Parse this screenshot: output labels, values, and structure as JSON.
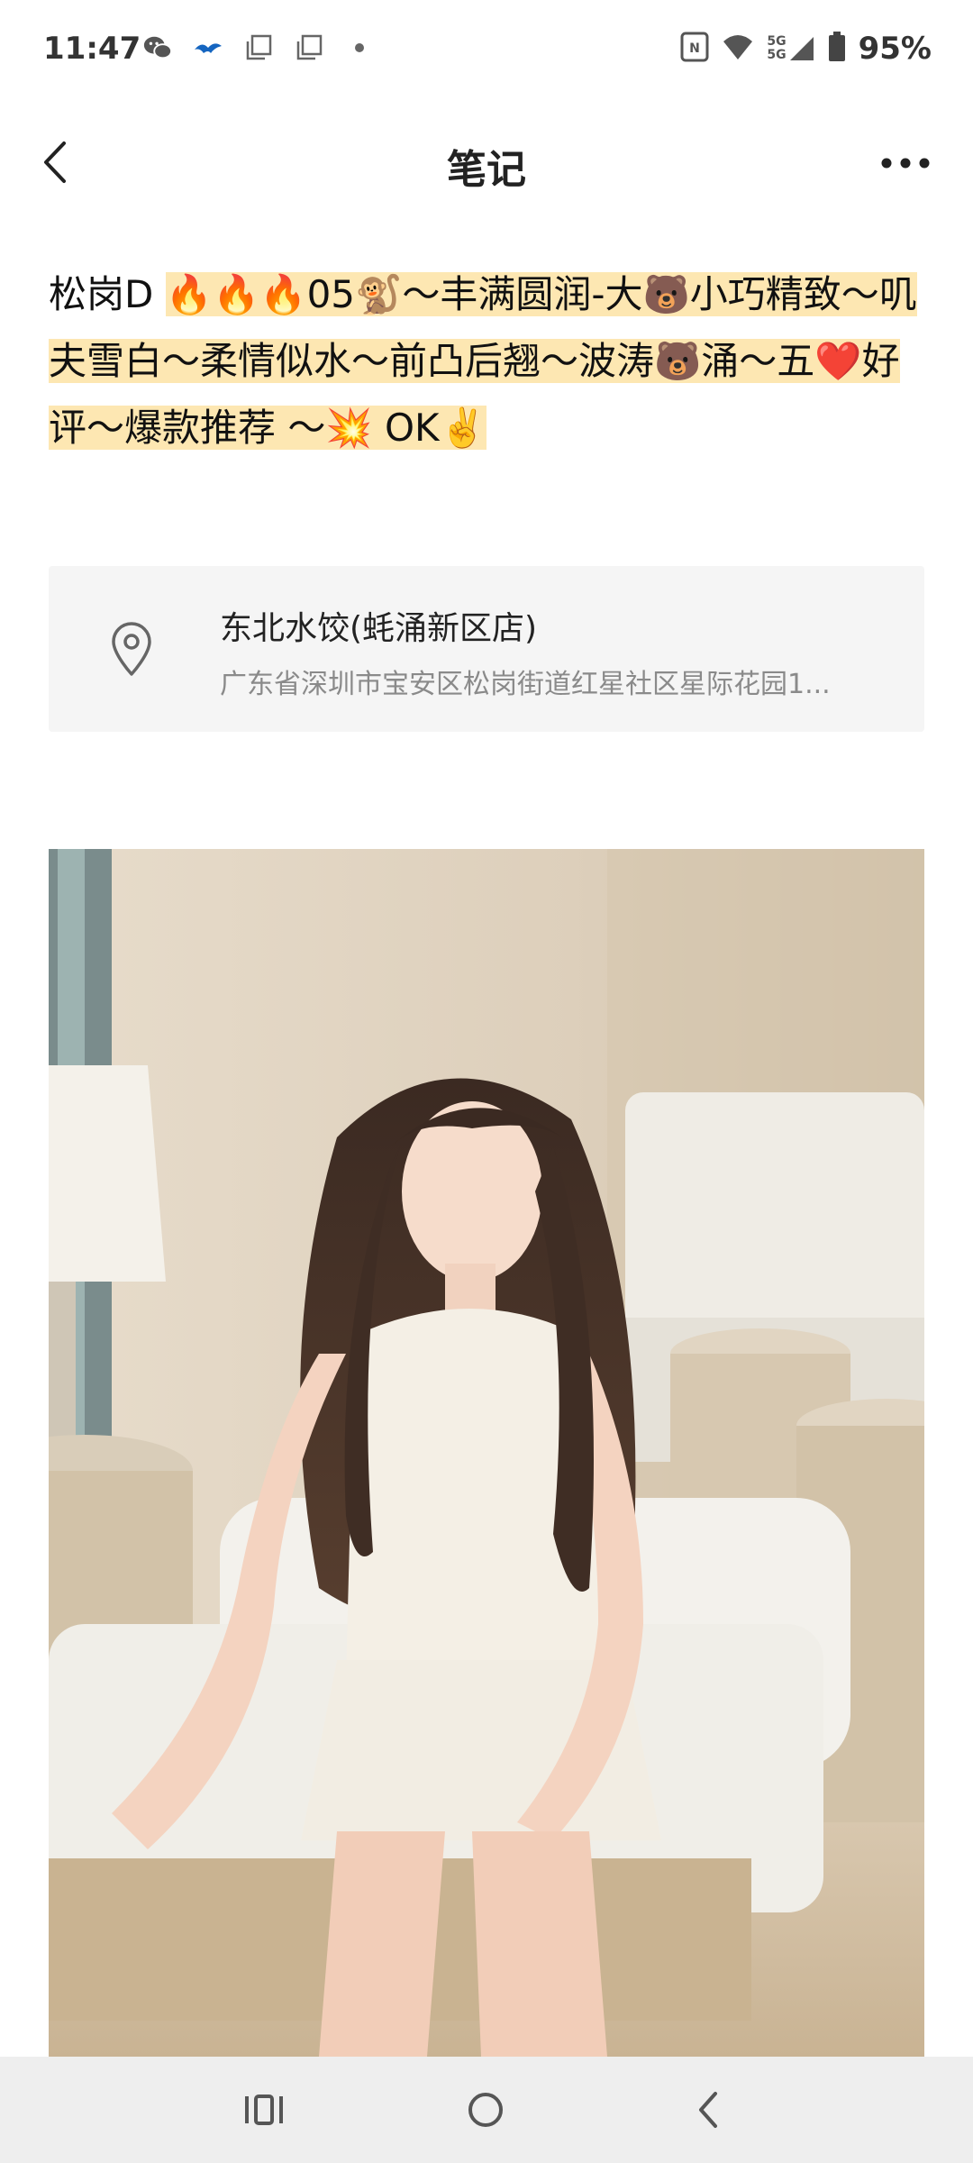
{
  "status_bar": {
    "time": "11:47",
    "battery": "95%",
    "icons": [
      "wechat-icon",
      "bird-app-icon",
      "copy-icon",
      "copy-icon",
      "dot-icon",
      "nfc-icon",
      "wifi-icon",
      "signal-5g-icon",
      "battery-icon"
    ],
    "network_top": "5G",
    "network_bottom": "5G"
  },
  "header": {
    "title": "笔记"
  },
  "note": {
    "prefix": "松岗D",
    "highlight": "🔥🔥🔥05🐒～丰满圆润-大🐻小巧精致～叽夫雪白～柔情似水～前凸后翘～波涛🐻涌～五❤️好评～爆款推荐 ～💥 OK✌️"
  },
  "location": {
    "name": "东北水饺(蚝涌新区店)",
    "address": "广东省深圳市宝安区松岗街道红星社区星际花园1..."
  },
  "colors": {
    "highlight": "#fde7b2",
    "card_bg": "#f5f5f5",
    "nav_bg": "#eeeeee"
  },
  "nav": {
    "icons": [
      "recent-apps-icon",
      "home-icon",
      "back-icon"
    ]
  }
}
